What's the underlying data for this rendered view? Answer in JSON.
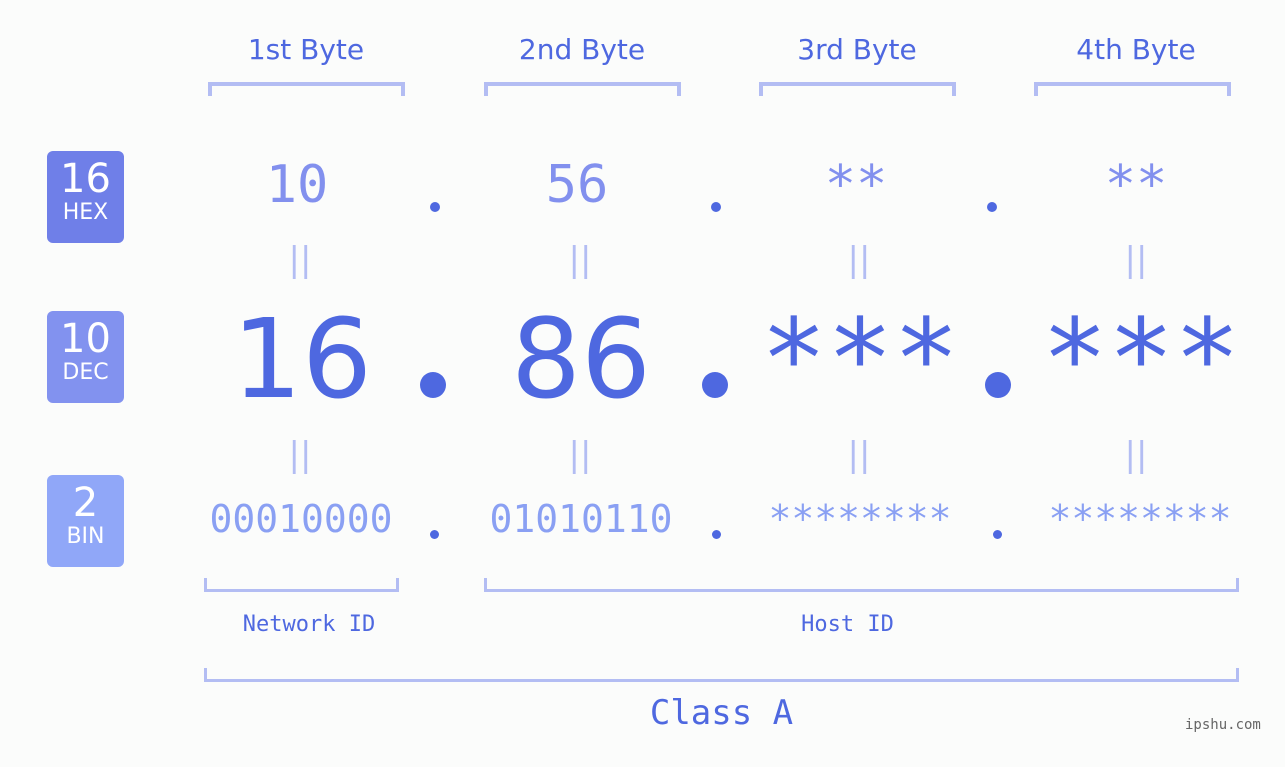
{
  "bytes": [
    {
      "label": "1st Byte",
      "hex": "10",
      "dec": "16",
      "bin": "00010000"
    },
    {
      "label": "2nd Byte",
      "hex": "56",
      "dec": "86",
      "bin": "01010110"
    },
    {
      "label": "3rd Byte",
      "hex": "**",
      "dec": "***",
      "bin": "********"
    },
    {
      "label": "4th Byte",
      "hex": "**",
      "dec": "***",
      "bin": "********"
    }
  ],
  "badges": {
    "hex": {
      "num": "16",
      "unit": "HEX",
      "color": "#6f7fe8"
    },
    "dec": {
      "num": "10",
      "unit": "DEC",
      "color": "#8292ef"
    },
    "bin": {
      "num": "2",
      "unit": "BIN",
      "color": "#90a7f8"
    }
  },
  "equals_symbol": "||",
  "network_id_label": "Network ID",
  "host_id_label": "Host ID",
  "class_label": "Class A",
  "watermark": "ipshu.com",
  "colors": {
    "accent": "#4e68e0",
    "light": "#b3bdf3"
  }
}
